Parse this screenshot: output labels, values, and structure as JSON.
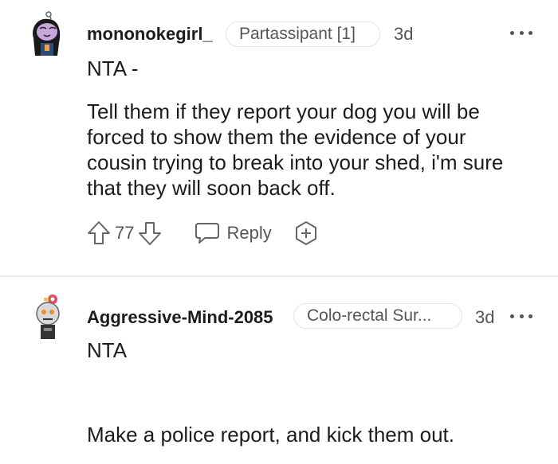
{
  "comments": [
    {
      "username": "mononokegirl_",
      "flair": "Partassipant [1]",
      "age": "3d",
      "lines": [
        "NTA -",
        "Tell them if they report your dog you will be",
        "forced to show them the evidence of your",
        "cousin trying to break into your shed, i'm sure",
        "that they will soon back off."
      ],
      "votes": "77",
      "reply_label": "Reply"
    },
    {
      "username": "Aggressive-Mind-2085",
      "flair": "Colo-rectal Sur...",
      "age": "3d",
      "lines": [
        "NTA",
        "Make a police report, and kick them out."
      ]
    }
  ],
  "icons": {
    "more": "more-options-icon",
    "upvote": "upvote-arrow-icon",
    "downvote": "downvote-arrow-icon",
    "reply": "speech-bubble-icon",
    "award": "award-plus-icon"
  },
  "colors": {
    "text": "#1c1c1c",
    "meta": "#555555",
    "divider": "#ededed"
  }
}
